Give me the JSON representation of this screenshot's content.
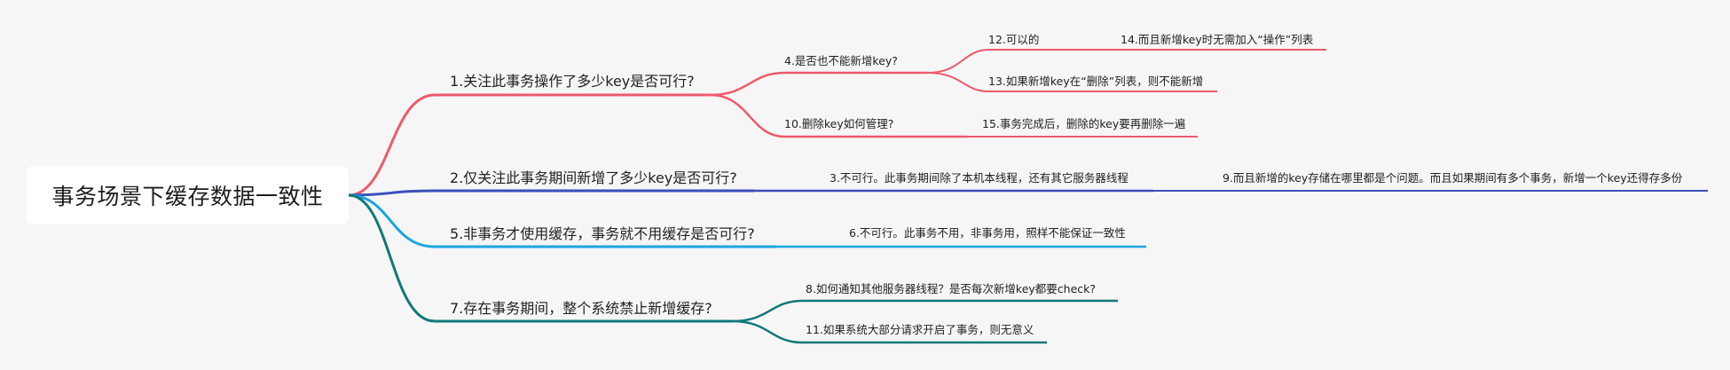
{
  "root": {
    "label": "事务场景下缓存数据一致性"
  },
  "branches": [
    {
      "id": "b1",
      "label": "1.关注此事务操作了多少key是否可行?",
      "color": "#ee5a6c",
      "children": [
        {
          "id": "b1c1",
          "label": "4.是否也不能新增key?",
          "children": [
            {
              "id": "b1c1g1",
              "label": "12.可以的",
              "children": [
                {
                  "id": "b1c1g1x1",
                  "label": "14.而且新增key时无需加入“操作”列表"
                }
              ]
            },
            {
              "id": "b1c1g2",
              "label": "13.如果新增key在“删除”列表，则不能新增"
            }
          ]
        },
        {
          "id": "b1c2",
          "label": "10.删除key如何管理?",
          "children": [
            {
              "id": "b1c2g1",
              "label": "15.事务完成后，删除的key要再删除一遍"
            }
          ]
        }
      ]
    },
    {
      "id": "b2",
      "label": "2.仅关注此事务期间新增了多少key是否可行?",
      "color": "#3b4fb8",
      "children": [
        {
          "id": "b2c1",
          "label": "3.不可行。此事务期间除了本机本线程，还有其它服务器线程",
          "children": [
            {
              "id": "b2c1g1",
              "label": "9.而且新增的key存储在哪里都是个问题。而且如果期间有多个事务，新增一个key还得存多份"
            }
          ]
        }
      ]
    },
    {
      "id": "b3",
      "label": "5.非事务才使用缓存，事务就不用缓存是否可行?",
      "color": "#1aa6e0",
      "children": [
        {
          "id": "b3c1",
          "label": "6.不可行。此事务不用，非事务用，照样不能保证一致性"
        }
      ]
    },
    {
      "id": "b4",
      "label": "7.存在事务期间，整个系统禁止新增缓存?",
      "color": "#11787a",
      "children": [
        {
          "id": "b4c1",
          "label": "8.如何通知其他服务器线程？是否每次新增key都要check?"
        },
        {
          "id": "b4c2",
          "label": "11.如果系统大部分请求开启了事务，则无意义"
        }
      ]
    }
  ]
}
